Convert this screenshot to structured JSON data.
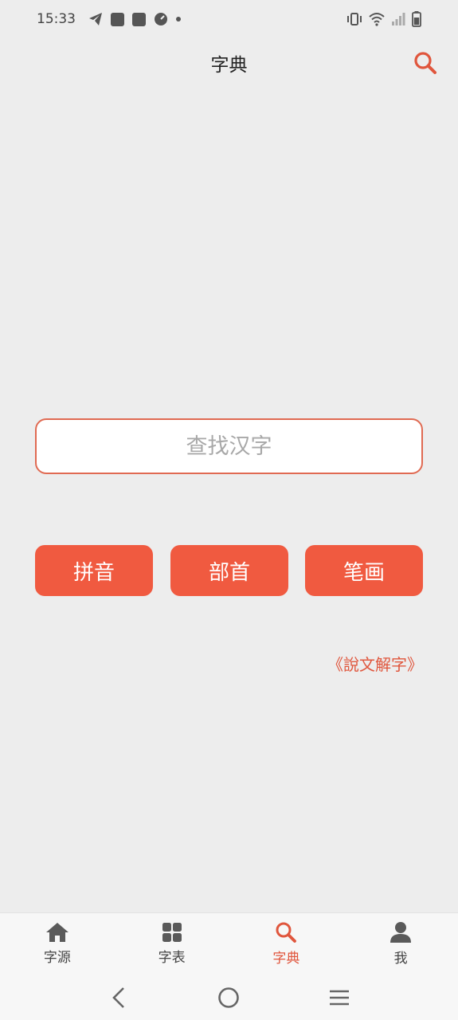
{
  "status_bar": {
    "time": "15:33"
  },
  "header": {
    "title": "字典"
  },
  "search": {
    "placeholder": "查找汉字"
  },
  "buttons": {
    "pinyin": "拼音",
    "radical": "部首",
    "stroke": "笔画"
  },
  "link": {
    "shuowen": "《說文解字》"
  },
  "bottom_nav": {
    "items": [
      {
        "label": "字源",
        "icon": "home-icon"
      },
      {
        "label": "字表",
        "icon": "grid-icon"
      },
      {
        "label": "字典",
        "icon": "search-icon",
        "active": true
      },
      {
        "label": "我",
        "icon": "user-icon"
      }
    ]
  },
  "colors": {
    "accent": "#f05a40",
    "background": "#ededed"
  }
}
